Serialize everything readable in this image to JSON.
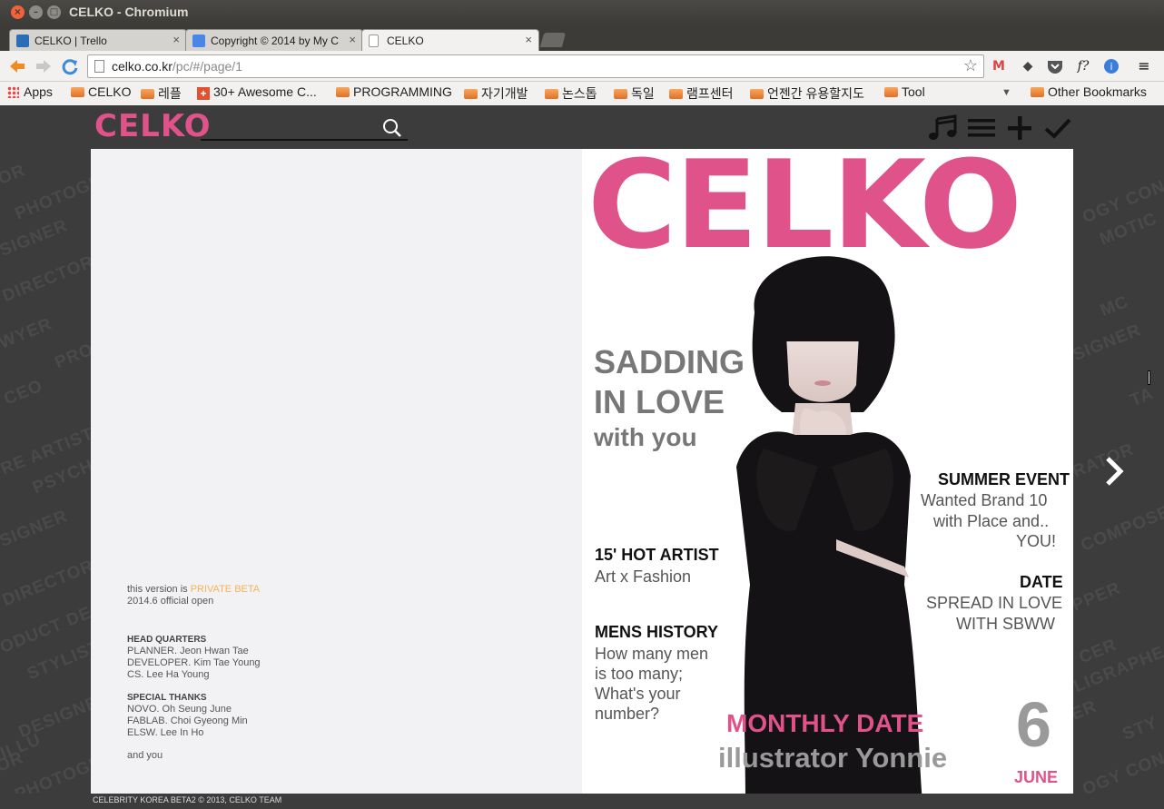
{
  "window": {
    "title": "CELKO - Chromium"
  },
  "tabs": [
    {
      "label": "CELKO | Trello",
      "favicon_color": "#2c6eb5",
      "active": false
    },
    {
      "label": "Copyright © 2014 by My C",
      "favicon_color": "#4a86e8",
      "active": false
    },
    {
      "label": "CELKO",
      "favicon_color": "#ffffff",
      "active": true
    }
  ],
  "tab_close": "×",
  "toolbar": {
    "url_host": "celko.co.kr",
    "url_path": "/pc/#/page/1",
    "back": "back-icon",
    "forward": "forward-icon",
    "reload": "reload-icon",
    "extensions": [
      "gmail-icon",
      "evernote-icon",
      "pocket-icon",
      "f?",
      "extension-badge-icon",
      "menu-icon"
    ],
    "ext_f_label": "f?"
  },
  "bookmarks": [
    {
      "label": "Apps",
      "icon": "apps-icon"
    },
    {
      "label": "CELKO",
      "icon": "folder"
    },
    {
      "label": "레플",
      "icon": "folder"
    },
    {
      "label": "30+ Awesome C...",
      "icon": "plus-icon"
    },
    {
      "label": "PROGRAMMING",
      "icon": "folder"
    },
    {
      "label": "자기개발",
      "icon": "folder"
    },
    {
      "label": "논스톱",
      "icon": "folder"
    },
    {
      "label": "독일",
      "icon": "folder"
    },
    {
      "label": "램프센터",
      "icon": "folder"
    },
    {
      "label": "언젠간 유용할지도",
      "icon": "folder"
    },
    {
      "label": "Tool",
      "icon": "folder"
    },
    {
      "label": "Other Bookmarks",
      "icon": "folder"
    }
  ],
  "site": {
    "brand": "CELKO",
    "accent": "#e0528a",
    "bg_words": [
      "OR",
      "PHOTOGR",
      "SIGNER",
      "DIRECTOR",
      "WYER",
      "PRO",
      "CEO",
      "RE ARTIST",
      "PSYCHO",
      "SIGNER",
      "DIRECTOR",
      "ODUCT DESIG",
      "STYLIST",
      "DESIGNER",
      "ILLU",
      "OR",
      "PHOTOGR",
      "OGY CON",
      "MOTIC",
      "MC",
      "SIGNER",
      "TA",
      "RATOR",
      "COMPOSE",
      "PPER",
      "CER",
      "LIGRAPHE",
      "ER",
      "STY",
      "OGY CON"
    ],
    "left_page": {
      "version_prefix": "this version is ",
      "version_beta": "PRIVATE BETA",
      "version_open": "2014.6 official open",
      "hq_heading": "HEAD QUARTERS",
      "hq_lines": [
        "PLANNER. Jeon Hwan Tae",
        "DEVELOPER. Kim Tae Young",
        "CS. Lee Ha Young"
      ],
      "thanks_heading": "SPECIAL THANKS",
      "thanks_lines": [
        "NOVO. Oh Seung June",
        "FABLAB. Choi Gyeong Min",
        "ELSW. Lee In Ho"
      ],
      "and_you": "and you"
    },
    "cover": {
      "title": "CELKO",
      "headline_1": "SADDING",
      "headline_2": "IN LOVE",
      "headline_3": "with you",
      "summer_title": "SUMMER EVENT",
      "summer_1": "Wanted Brand 10",
      "summer_2": "with Place and..",
      "summer_3": "YOU!",
      "artist_title": "15' HOT ARTIST",
      "artist_sub": "Art x Fashion",
      "date_title": "DATE",
      "date_1": "SPREAD IN LOVE",
      "date_2": "WITH SBWW",
      "mens_title": "MENS HISTORY",
      "mens_1": "How many men",
      "mens_2": "is too many;",
      "mens_3": "What's your",
      "mens_4": "number?",
      "monthly": "MONTHLY DATE",
      "illustrator": "illustrator Yonnie",
      "issue_num": "6",
      "issue_month": "JUNE"
    },
    "footer": "CELEBRITY KOREA BETA2 © 2013, CELKO TEAM"
  }
}
